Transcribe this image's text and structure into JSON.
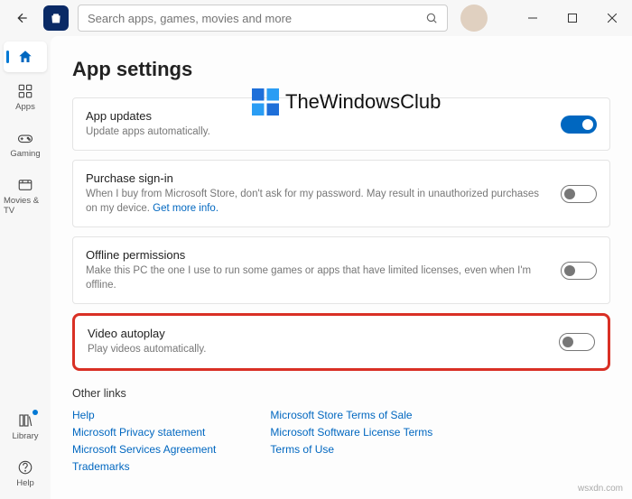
{
  "titlebar": {
    "search_placeholder": "Search apps, games, movies and more"
  },
  "sidebar": {
    "home": "",
    "apps": "Apps",
    "gaming": "Gaming",
    "movies": "Movies & TV",
    "library": "Library",
    "help": "Help"
  },
  "page": {
    "title": "App settings"
  },
  "cards": {
    "updates": {
      "title": "App updates",
      "desc": "Update apps automatically."
    },
    "signin": {
      "title": "Purchase sign-in",
      "desc": "When I buy from Microsoft Store, don't ask for my password. May result in unauthorized purchases on my device. ",
      "link": "Get more info."
    },
    "offline": {
      "title": "Offline permissions",
      "desc": "Make this PC the one I use to run some games or apps that have limited licenses, even when I'm offline."
    },
    "video": {
      "title": "Video autoplay",
      "desc": "Play videos automatically."
    }
  },
  "other": {
    "title": "Other links",
    "col1": [
      "Help",
      "Microsoft Privacy statement",
      "Microsoft Services Agreement",
      "Trademarks"
    ],
    "col2": [
      "Microsoft Store Terms of Sale",
      "Microsoft Software License Terms",
      "Terms of Use"
    ]
  },
  "watermark": {
    "text": "TheWindowsClub",
    "domain": "wsxdn.com"
  }
}
